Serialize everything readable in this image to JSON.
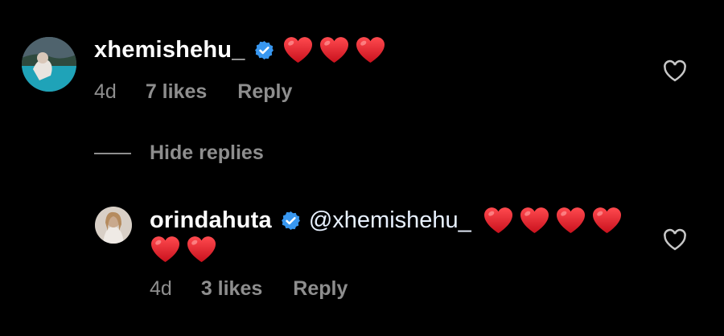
{
  "comments": [
    {
      "username": "xhemishehu_",
      "text": "",
      "hearts": 3,
      "time": "4d",
      "likes": "7 likes",
      "reply": "Reply"
    }
  ],
  "hide_replies": "Hide replies",
  "replies": [
    {
      "username": "orindahuta",
      "mention": "@xhemishehu_",
      "hearts_line1": 4,
      "hearts_line2": 2,
      "time": "4d",
      "likes": "3 likes",
      "reply": "Reply"
    }
  ],
  "icons": {
    "verified": "verified-badge-icon",
    "heart_emoji": "red-heart-emoji",
    "like": "heart-outline-icon"
  },
  "colors": {
    "background": "#000000",
    "verified_blue": "#3897f0",
    "heart_red": "#e0232f",
    "meta_gray": "#8e8e8e"
  }
}
